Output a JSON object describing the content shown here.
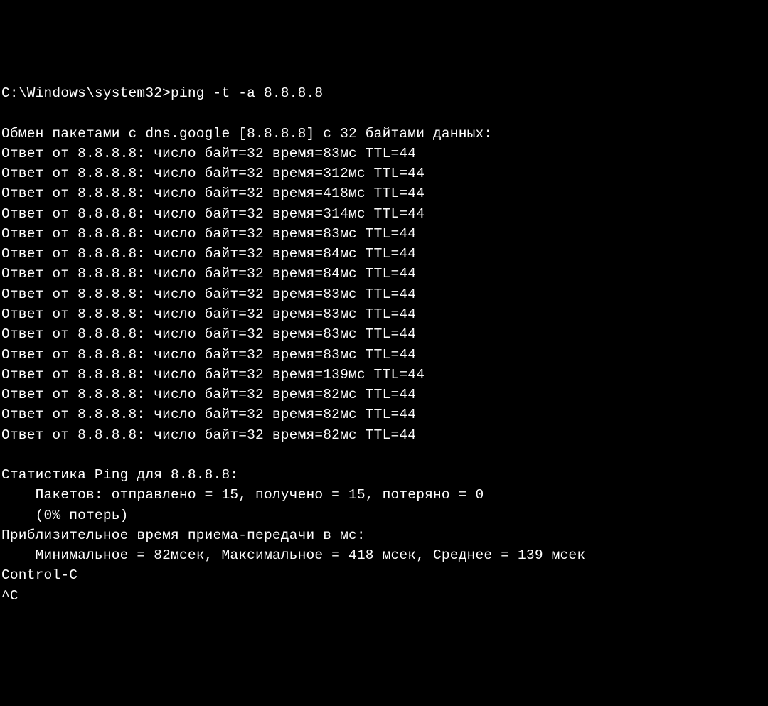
{
  "prompt": {
    "path": "C:\\Windows\\system32>",
    "command": "ping -t -a 8.8.8.8"
  },
  "header": "Обмен пакетами с dns.google [8.8.8.8] с 32 байтами данных:",
  "replies": [
    "Ответ от 8.8.8.8: число байт=32 время=83мс TTL=44",
    "Ответ от 8.8.8.8: число байт=32 время=312мс TTL=44",
    "Ответ от 8.8.8.8: число байт=32 время=418мс TTL=44",
    "Ответ от 8.8.8.8: число байт=32 время=314мс TTL=44",
    "Ответ от 8.8.8.8: число байт=32 время=83мс TTL=44",
    "Ответ от 8.8.8.8: число байт=32 время=84мс TTL=44",
    "Ответ от 8.8.8.8: число байт=32 время=84мс TTL=44",
    "Ответ от 8.8.8.8: число байт=32 время=83мс TTL=44",
    "Ответ от 8.8.8.8: число байт=32 время=83мс TTL=44",
    "Ответ от 8.8.8.8: число байт=32 время=83мс TTL=44",
    "Ответ от 8.8.8.8: число байт=32 время=83мс TTL=44",
    "Ответ от 8.8.8.8: число байт=32 время=139мс TTL=44",
    "Ответ от 8.8.8.8: число байт=32 время=82мс TTL=44",
    "Ответ от 8.8.8.8: число байт=32 время=82мс TTL=44",
    "Ответ от 8.8.8.8: число байт=32 время=82мс TTL=44"
  ],
  "stats": {
    "title": "Статистика Ping для 8.8.8.8:",
    "packets": "    Пакетов: отправлено = 15, получено = 15, потеряно = 0",
    "loss": "    (0% потерь)",
    "rtt_title": "Приблизительное время приема-передачи в мс:",
    "rtt_values": "    Минимальное = 82мсек, Максимальное = 418 мсек, Среднее = 139 мсек"
  },
  "interrupt": {
    "label": "Control-C",
    "signal": "^C"
  }
}
